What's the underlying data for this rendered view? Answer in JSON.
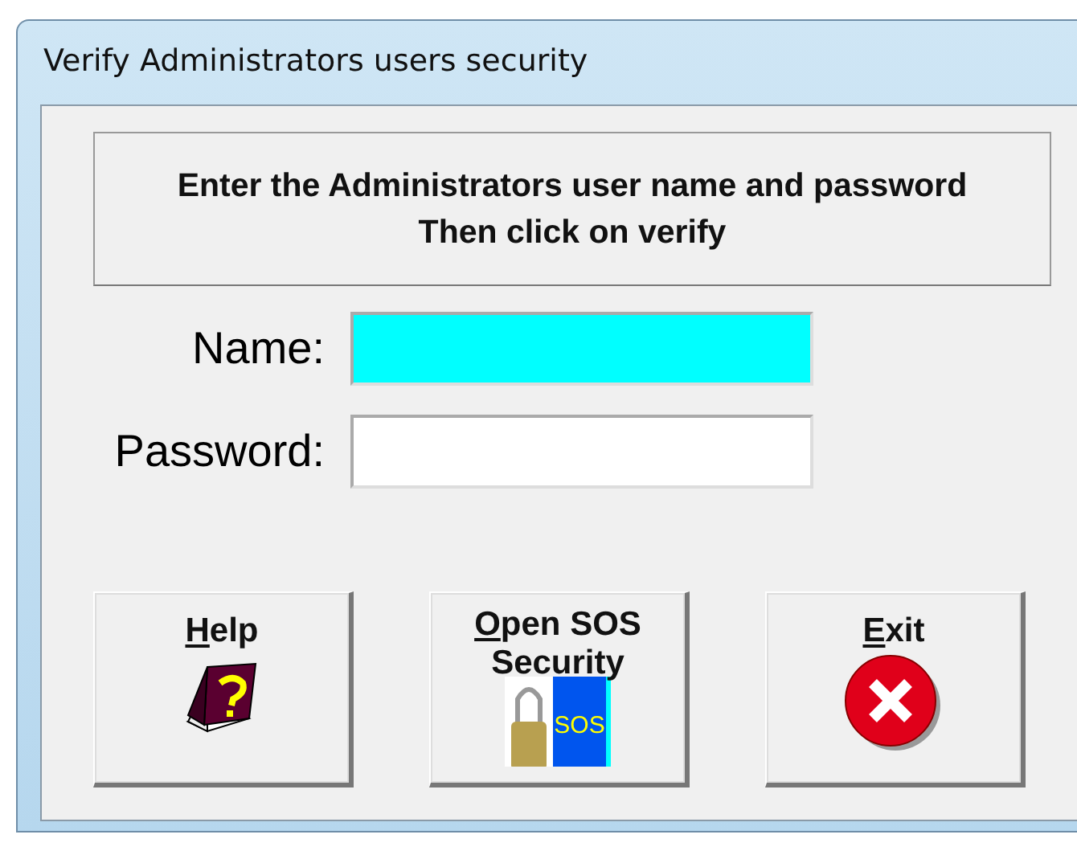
{
  "window": {
    "title": "Verify Administrators users security"
  },
  "instructions": [
    "Enter the Administrators user name and password",
    "Then click on verify"
  ],
  "fields": [
    {
      "label": "Name:",
      "focused": true
    },
    {
      "label": "Password:",
      "focused": false
    }
  ],
  "buttons": [
    {
      "kind": "help",
      "underlined": "H",
      "rest": "elp"
    },
    {
      "kind": "sos",
      "underlined": "O",
      "rest": "pen SOS Security",
      "icon_text": "SOS"
    },
    {
      "kind": "exit",
      "underlined": "E",
      "rest": "xit"
    }
  ]
}
